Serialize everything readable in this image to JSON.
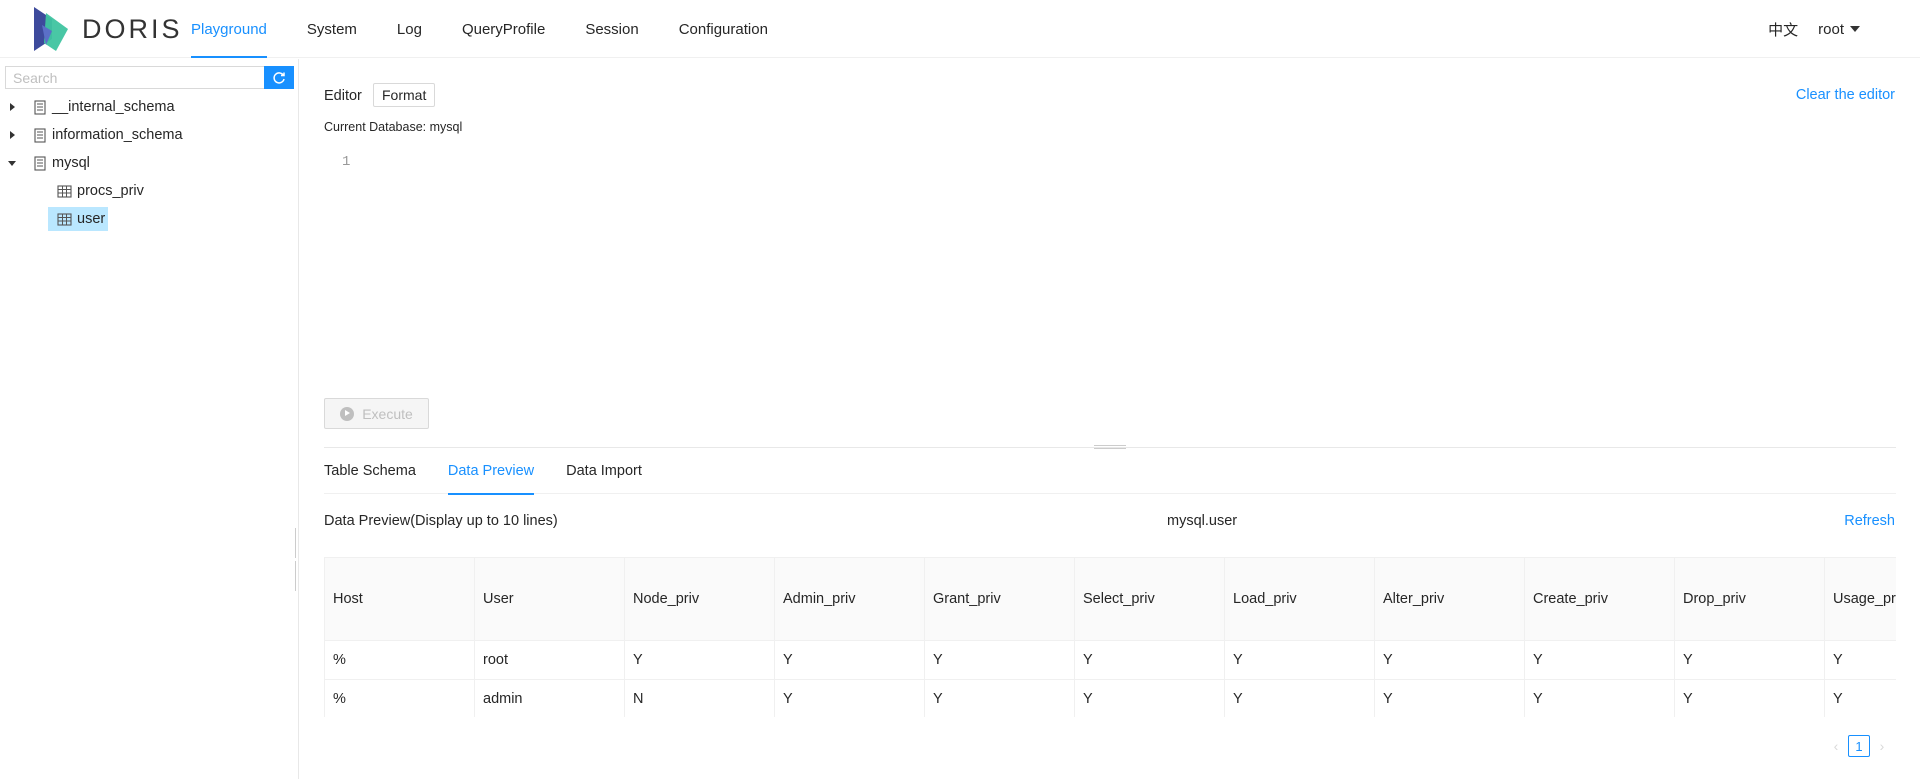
{
  "app": {
    "logo_text": "DORIS"
  },
  "nav": {
    "items": [
      {
        "label": "Playground",
        "active": true
      },
      {
        "label": "System"
      },
      {
        "label": "Log"
      },
      {
        "label": "QueryProfile"
      },
      {
        "label": "Session"
      },
      {
        "label": "Configuration"
      }
    ],
    "language": "中文",
    "user": "root"
  },
  "sidebar": {
    "search_placeholder": "Search",
    "tree": [
      {
        "label": "__internal_schema",
        "expanded": false
      },
      {
        "label": "information_schema",
        "expanded": false
      },
      {
        "label": "mysql",
        "expanded": true,
        "children": [
          {
            "label": "procs_priv"
          },
          {
            "label": "user",
            "selected": true
          }
        ]
      }
    ]
  },
  "editor": {
    "label": "Editor",
    "format_label": "Format",
    "clear_label": "Clear the editor",
    "current_database": "Current Database: mysql",
    "line_number": "1",
    "execute_label": "Execute"
  },
  "result_tabs": [
    {
      "label": "Table Schema"
    },
    {
      "label": "Data Preview",
      "active": true
    },
    {
      "label": "Data Import"
    }
  ],
  "preview": {
    "title": "Data Preview(Display up to 10 lines)",
    "table_name": "mysql.user",
    "refresh_label": "Refresh",
    "columns": [
      "Host",
      "User",
      "Node_priv",
      "Admin_priv",
      "Grant_priv",
      "Select_priv",
      "Load_priv",
      "Alter_priv",
      "Create_priv",
      "Drop_priv",
      "Usage_priv"
    ],
    "rows": [
      [
        "%",
        "root",
        "Y",
        "Y",
        "Y",
        "Y",
        "Y",
        "Y",
        "Y",
        "Y",
        "Y"
      ],
      [
        "%",
        "admin",
        "N",
        "Y",
        "Y",
        "Y",
        "Y",
        "Y",
        "Y",
        "Y",
        "Y"
      ]
    ],
    "page": "1"
  },
  "colors": {
    "accent": "#1890ff",
    "selected_bg": "#bae7ff",
    "logo_dark": "#3d4a9c",
    "logo_teal": "#3fc4a0"
  }
}
